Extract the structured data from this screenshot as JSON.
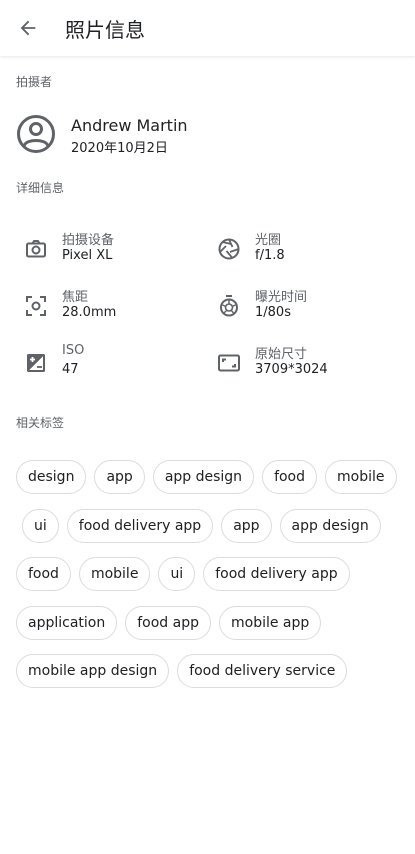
{
  "header": {
    "title": "照片信息"
  },
  "owner": {
    "section_label": "拍摄者",
    "name": "Andrew Martin",
    "date": "2020年10月2日"
  },
  "details": {
    "section_label": "详细信息",
    "items": [
      {
        "icon": "camera-icon",
        "label": "拍摄设备",
        "value": "Pixel XL"
      },
      {
        "icon": "aperture-icon",
        "label": "光圈",
        "value": "f/1.8"
      },
      {
        "icon": "focus-icon",
        "label": "焦距",
        "value": "28.0mm"
      },
      {
        "icon": "timer-icon",
        "label": "曝光时间",
        "value": "1/80s"
      },
      {
        "icon": "exposure-icon",
        "label": "ISO",
        "value": "47"
      },
      {
        "icon": "aspect-ratio-icon",
        "label": "原始尺寸",
        "value": "3709*3024"
      }
    ]
  },
  "tags": {
    "section_label": "相关标签",
    "rows": [
      [
        "design",
        "app",
        "app design",
        "food",
        "mobile"
      ],
      [
        "ui",
        "food delivery app",
        "app",
        "app design"
      ],
      [
        "food",
        "mobile",
        "ui",
        "food delivery app"
      ],
      [
        "application",
        "food app",
        "mobile app"
      ],
      [
        "mobile app design",
        "food delivery service"
      ]
    ]
  }
}
